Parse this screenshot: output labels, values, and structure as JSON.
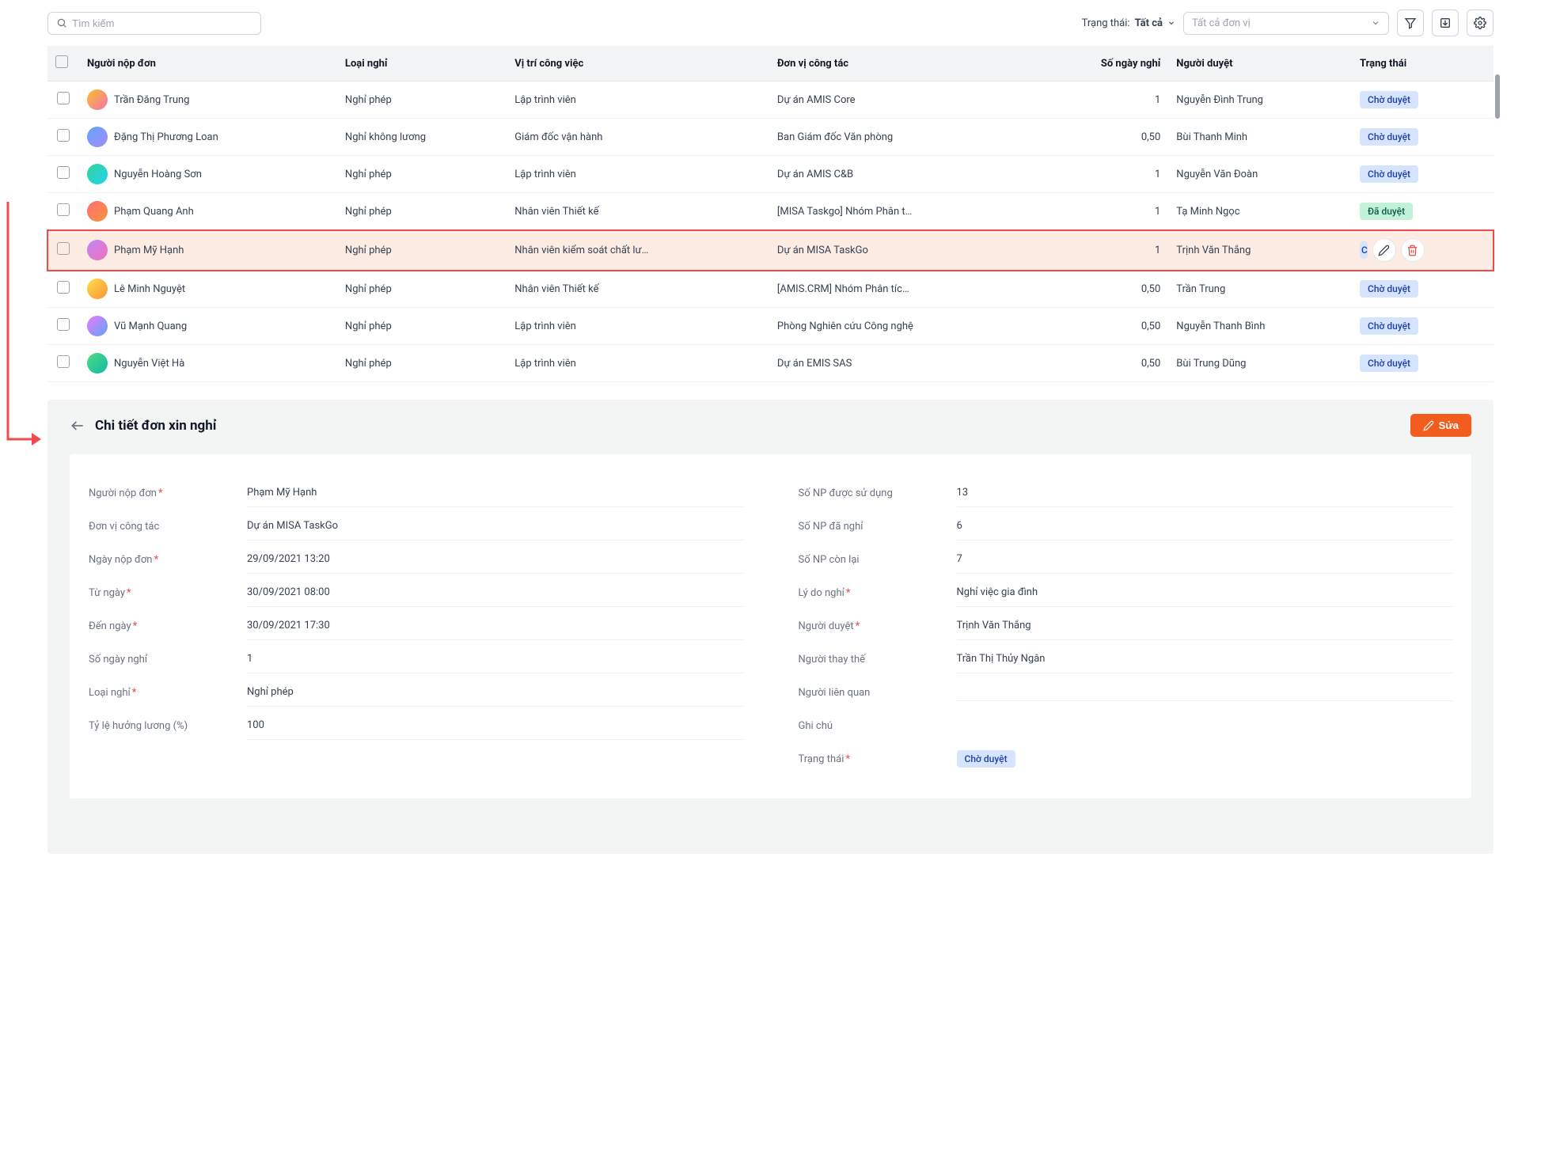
{
  "toolbar": {
    "search_placeholder": "Tìm kiếm",
    "status_label": "Trạng thái:",
    "status_value": "Tất cả",
    "dept_placeholder": "Tất cả đơn vị"
  },
  "columns": {
    "applicant": "Người nộp đơn",
    "leave_type": "Loại nghỉ",
    "position": "Vị trí công việc",
    "department": "Đơn vị công tác",
    "days": "Số ngày nghỉ",
    "approver": "Người duyệt",
    "status": "Trạng thái"
  },
  "rows": [
    {
      "name": "Trần Đăng Trung",
      "type": "Nghỉ phép",
      "pos": "Lập trình viên",
      "dept": "Dự án AMIS Core",
      "days": "1",
      "approver": "Nguyễn Đình Trung",
      "status": "Chờ duyệt",
      "status_kind": "pending"
    },
    {
      "name": "Đặng Thị Phương Loan",
      "type": "Nghỉ không lương",
      "pos": "Giám đốc vận hành",
      "dept": "Ban Giám đốc Văn phòng",
      "days": "0,50",
      "approver": "Bùi Thanh Minh",
      "status": "Chờ duyệt",
      "status_kind": "pending"
    },
    {
      "name": "Nguyễn Hoàng Sơn",
      "type": "Nghỉ phép",
      "pos": "Lập trình viên",
      "dept": "Dự án AMIS C&B",
      "days": "1",
      "approver": "Nguyễn Văn Đoàn",
      "status": "Chờ duyệt",
      "status_kind": "pending"
    },
    {
      "name": "Phạm Quang Anh",
      "type": "Nghỉ phép",
      "pos": "Nhân viên Thiết kế",
      "dept": "[MISA Taskgo] Nhóm Phân t…",
      "days": "1",
      "approver": "Tạ Minh Ngọc",
      "status": "Đã duyệt",
      "status_kind": "approved"
    },
    {
      "name": "Phạm Mỹ Hạnh",
      "type": "Nghỉ phép",
      "pos": "Nhân viên kiểm soát chất lư…",
      "dept": "Dự án MISA TaskGo",
      "days": "1",
      "approver": "Trịnh Văn Thắng",
      "status": "Chờ duyệt",
      "status_kind": "pending",
      "selected": true
    },
    {
      "name": "Lê Minh Nguyệt",
      "type": "Nghỉ phép",
      "pos": "Nhân viên Thiết kế",
      "dept": "[AMIS.CRM] Nhóm Phân tíc…",
      "days": "0,50",
      "approver": "Trần Trung",
      "status": "Chờ duyệt",
      "status_kind": "pending"
    },
    {
      "name": "Vũ Mạnh Quang",
      "type": "Nghỉ phép",
      "pos": "Lập trình viên",
      "dept": "Phòng Nghiên cứu Công nghệ",
      "days": "0,50",
      "approver": "Nguyễn Thanh Bình",
      "status": "Chờ duyệt",
      "status_kind": "pending"
    },
    {
      "name": "Nguyễn Việt Hà",
      "type": "Nghỉ phép",
      "pos": "Lập trình viên",
      "dept": "Dự án EMIS SAS",
      "days": "0,50",
      "approver": "Bùi Trung Dũng",
      "status": "Chờ duyệt",
      "status_kind": "pending"
    }
  ],
  "detail": {
    "title": "Chi tiết đơn xin nghỉ",
    "edit_label": "Sửa",
    "left": {
      "applicant_label": "Người nộp đơn",
      "applicant_value": "Phạm Mỹ Hạnh",
      "dept_label": "Đơn vị công tác",
      "dept_value": "Dự án MISA TaskGo",
      "submit_date_label": "Ngày nộp đơn",
      "submit_date_value": "29/09/2021 13:20",
      "from_label": "Từ ngày",
      "from_value": "30/09/2021 08:00",
      "to_label": "Đến ngày",
      "to_value": "30/09/2021 17:30",
      "days_label": "Số ngày nghỉ",
      "days_value": "1",
      "type_label": "Loại nghỉ",
      "type_value": "Nghỉ phép",
      "salary_label": "Tỷ lệ hưởng lương (%)",
      "salary_value": "100"
    },
    "right": {
      "np_avail_label": "Số NP được sử dụng",
      "np_avail_value": "13",
      "np_used_label": "Số NP đã nghỉ",
      "np_used_value": "6",
      "np_left_label": "Số NP còn lại",
      "np_left_value": "7",
      "reason_label": "Lý do nghỉ",
      "reason_value": "Nghỉ việc gia đình",
      "approver_label": "Người duyệt",
      "approver_value": "Trịnh Văn Thắng",
      "sub_label": "Người thay thế",
      "sub_value": "Trần Thị Thủy Ngân",
      "related_label": "Người liên quan",
      "related_value": "",
      "note_label": "Ghi chú",
      "note_value": "",
      "status_label": "Trạng thái",
      "status_value": "Chờ duyệt"
    }
  }
}
